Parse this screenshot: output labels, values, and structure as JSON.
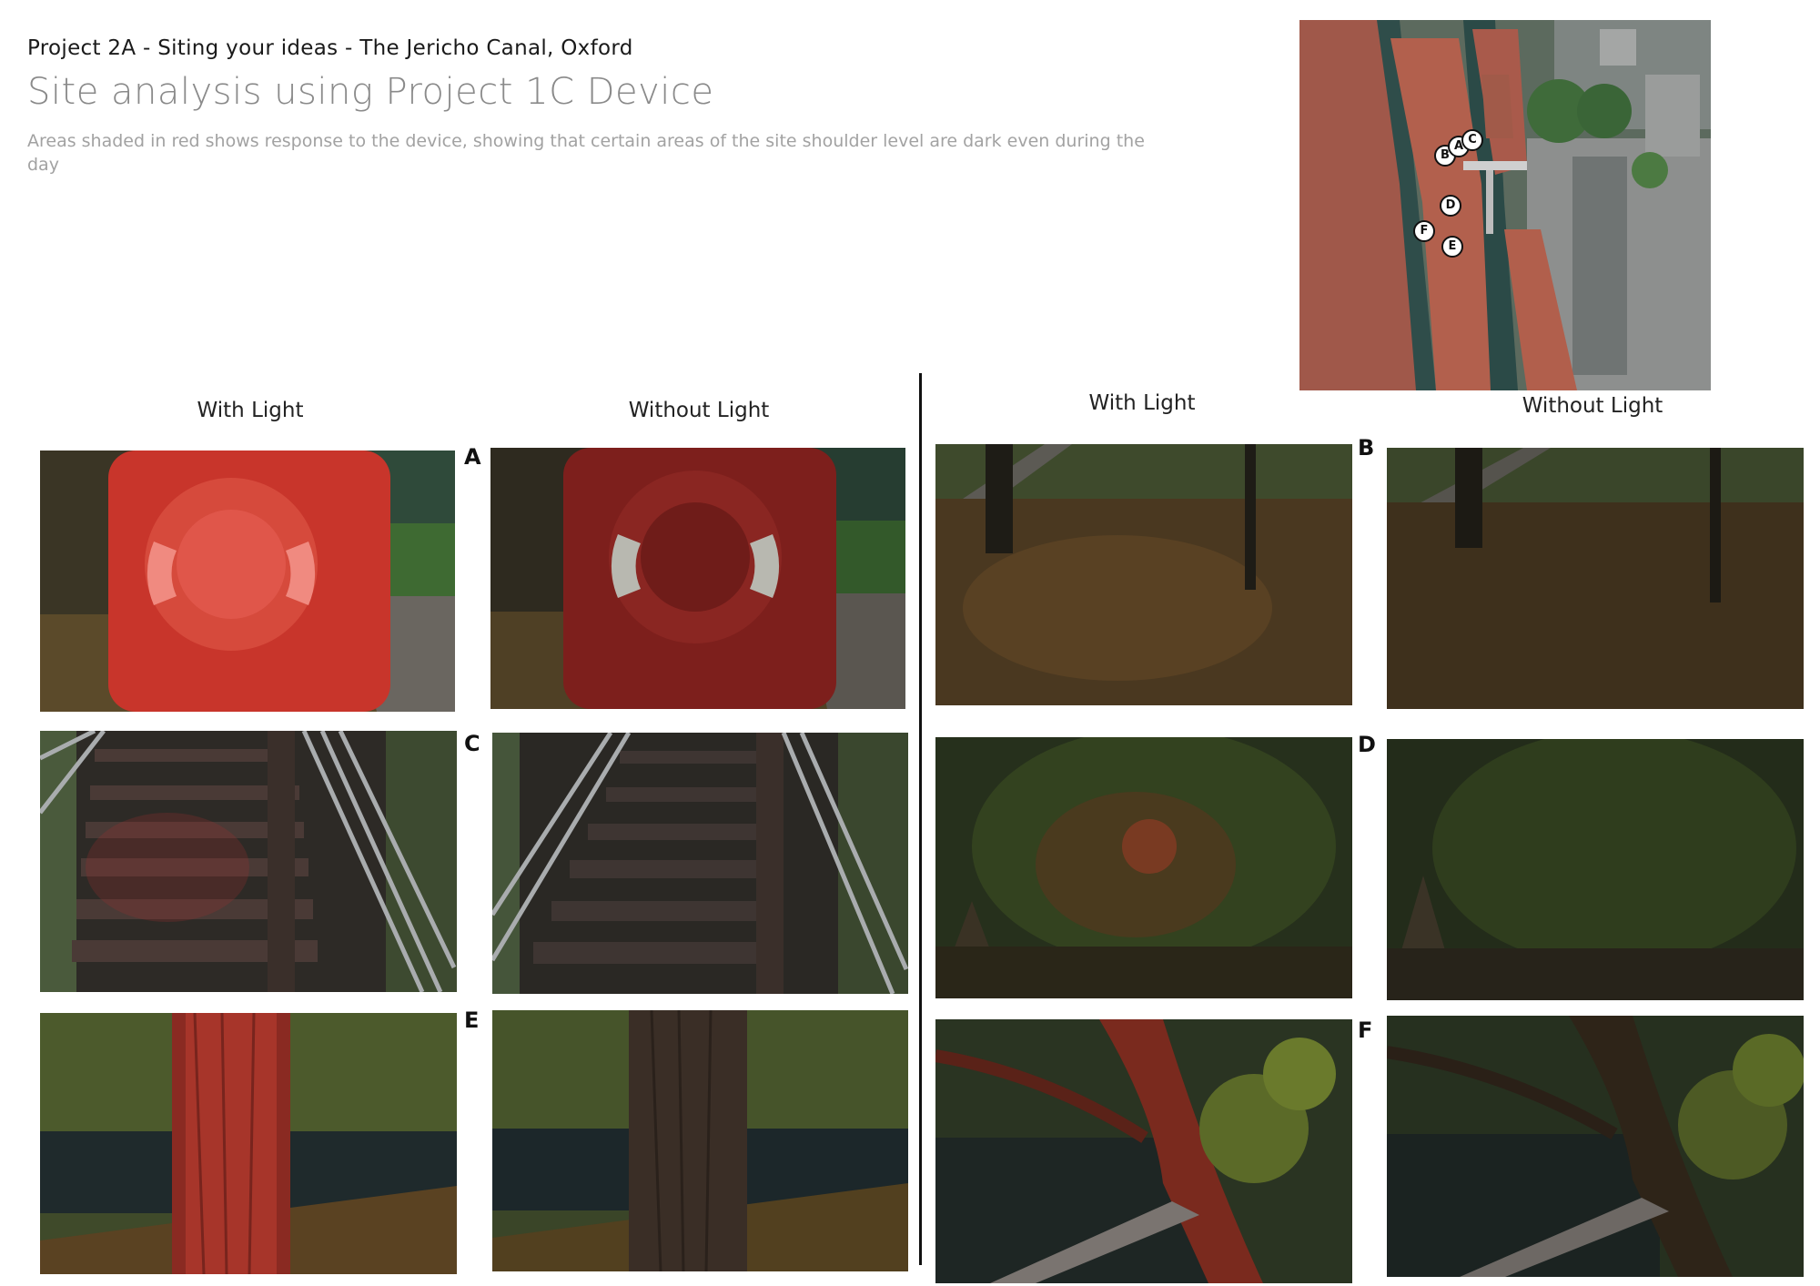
{
  "header": {
    "subtitle": "Project 2A - Siting your ideas - The Jericho Canal, Oxford",
    "title": "Site analysis using Project 1C Device",
    "description": "Areas shaded in red shows response to the device, showing that certain areas of the site shoulder level are dark even during the day"
  },
  "map": {
    "markers": [
      "A",
      "B",
      "C",
      "D",
      "E",
      "F"
    ]
  },
  "left_panel": {
    "with_label": "With Light",
    "without_label": "Without Light",
    "rows": [
      {
        "letter": "A",
        "scene": "lifebuoy-box"
      },
      {
        "letter": "C",
        "scene": "steps"
      },
      {
        "letter": "E",
        "scene": "tree-trunk"
      }
    ]
  },
  "right_panel": {
    "with_label": "With Light",
    "without_label": "Without Light",
    "rows": [
      {
        "letter": "B",
        "scene": "leaf-ground"
      },
      {
        "letter": "D",
        "scene": "bush"
      },
      {
        "letter": "F",
        "scene": "tree-canal"
      }
    ]
  },
  "colors": {
    "highlight_red": "#c0392b",
    "foliage_dark": "#2f3a22",
    "leaf_litter": "#6b4a22"
  }
}
